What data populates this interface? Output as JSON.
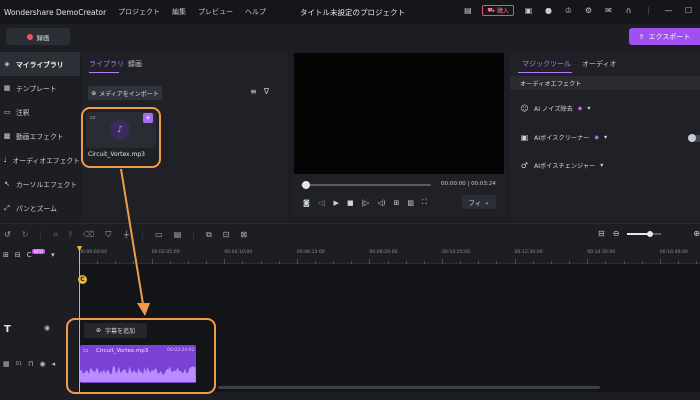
{
  "app": {
    "brand": "Wondershare DemoCreator",
    "menu": [
      "プロジェクト",
      "編集",
      "プレビュー",
      "ヘルプ"
    ],
    "doc_title": "タイトル未設定のプロジェクト",
    "buy_label": "購入",
    "accent": "#a14ff0",
    "highlight": "#f29b4b"
  },
  "toolbar": {
    "record_label": "録画",
    "export_label": "エクスポート"
  },
  "sidebar": {
    "items": [
      {
        "label": "マイライブラリ",
        "icon": "layers-icon"
      },
      {
        "label": "テンプレート",
        "icon": "template-icon"
      },
      {
        "label": "注釈",
        "icon": "annotation-icon"
      },
      {
        "label": "動画エフェクト",
        "icon": "video-effect-icon"
      },
      {
        "label": "オーディオエフェクト",
        "icon": "audio-effect-icon"
      },
      {
        "label": "カーソルエフェクト",
        "icon": "cursor-icon"
      },
      {
        "label": "パンとズーム",
        "icon": "pan-zoom-icon"
      }
    ]
  },
  "library": {
    "tab_library": "ライブラリ",
    "tab_record": "録画",
    "import_label": "メディアをインポート",
    "media_items": [
      {
        "name": "Circuit_Vortex.mp3"
      }
    ]
  },
  "preview": {
    "time_current": "00:00:00",
    "time_total": "00:03:24",
    "fit_label": "フィ"
  },
  "magic": {
    "tab_magic": "マジックツール",
    "tab_audio": "オーディオ",
    "section": "オーディオエフェクト",
    "effects": [
      {
        "label": "AI ノイズ除去"
      },
      {
        "label": "AIボイスクリーナー"
      },
      {
        "label": "AIボイスチェンジャー"
      }
    ]
  },
  "timeline": {
    "ruler": [
      "00:00:00:00",
      "00:02:05:00",
      "00:04:10:00",
      "00:06:15:00",
      "00:08:20:00",
      "00:10:25:00",
      "00:12:30:00",
      "00:14:35:00",
      "00:16:40:00"
    ],
    "new_badge": "NEW",
    "playhead_marker": "C",
    "subtitle_label": "字幕を追加",
    "track_number": "01",
    "clip": {
      "name": "Circuit_Vortex.mp3",
      "time": "00:03:24:02"
    }
  }
}
